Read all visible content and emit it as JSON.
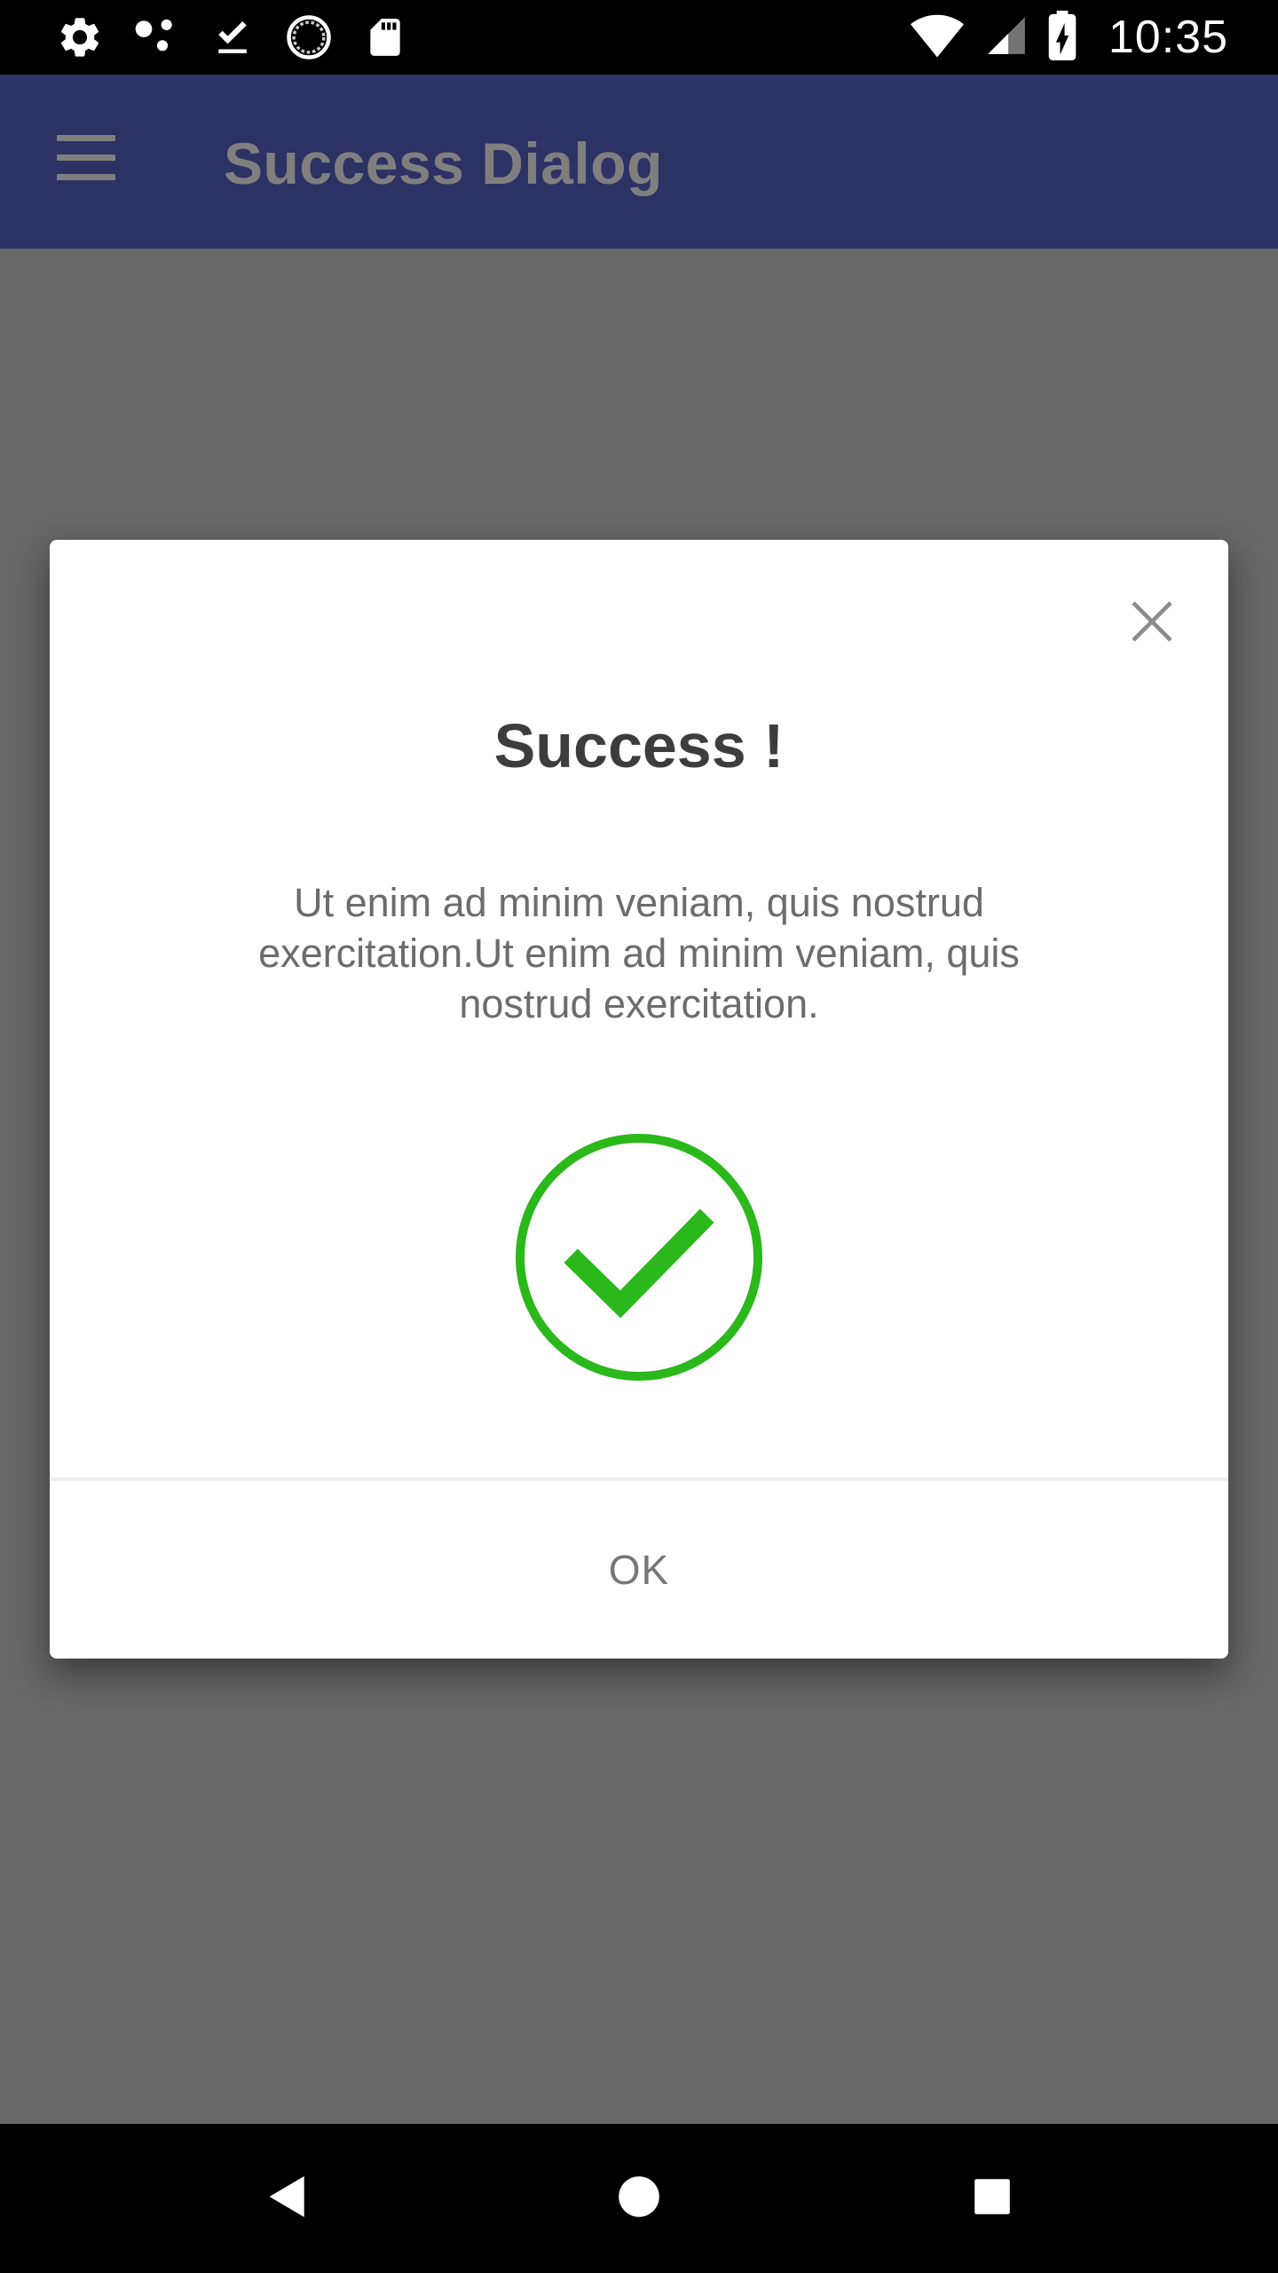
{
  "status_bar": {
    "time": "10:35",
    "left_icons": [
      "settings-icon",
      "share-icon",
      "download-done-icon",
      "sync-icon",
      "sd-card-icon"
    ],
    "right_icons": [
      "wifi-icon",
      "signal-icon",
      "battery-charging-icon"
    ]
  },
  "app_bar": {
    "title": "Success Dialog",
    "menu_icon": "hamburger-menu-icon",
    "color": "#5b64c8"
  },
  "dialog": {
    "title": "Success !",
    "message": "Ut enim ad minim veniam, quis nostrud exercitation.Ut enim ad minim veniam, quis nostrud exercitation.",
    "close_icon": "close-icon",
    "status_icon": "check-circle-icon",
    "accent_color": "#2ab81a",
    "ok_label": "OK"
  },
  "nav_bar": {
    "buttons": [
      "back-icon",
      "home-icon",
      "recents-icon"
    ]
  }
}
